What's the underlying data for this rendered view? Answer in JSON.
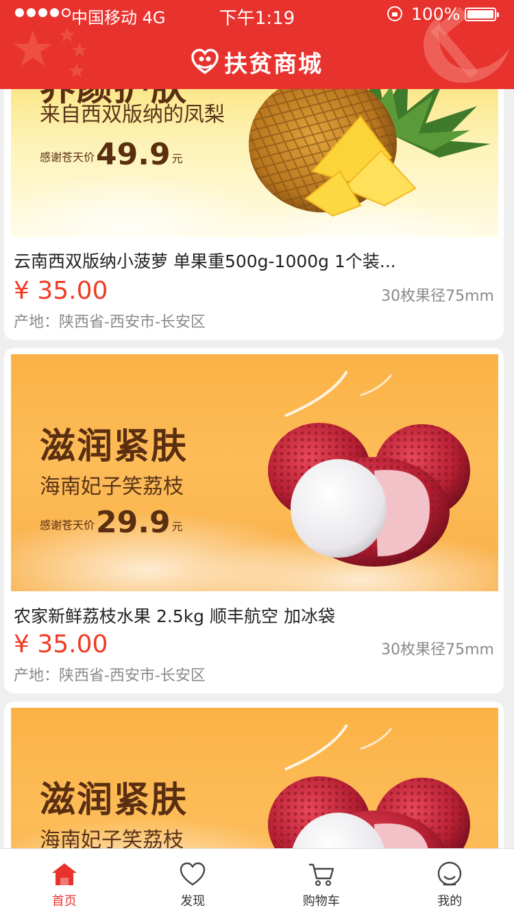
{
  "status_bar": {
    "carrier": "中国移动  4G",
    "time": "下午1:19",
    "battery": "100%"
  },
  "header": {
    "title": "扶贫商城"
  },
  "products": [
    {
      "banner": {
        "heading": "养颜护肤",
        "subheading": "来自西双版纳的凤梨",
        "price_label": "感谢苍天价",
        "price": "49.9",
        "unit": "元",
        "fruit": "pineapple"
      },
      "title": "云南西双版纳小菠萝 单果重500g-1000g 1个装...",
      "price": "¥ 35.00",
      "spec": "30枚果径75mm",
      "origin": "产地：陕西省-西安市-长安区"
    },
    {
      "banner": {
        "heading": "滋润紧肤",
        "subheading": "海南妃子笑荔枝",
        "price_label": "感谢苍天价",
        "price": "29.9",
        "unit": "元",
        "fruit": "lychee"
      },
      "title": "农家新鲜荔枝水果 2.5kg 顺丰航空 加冰袋",
      "price": "¥ 35.00",
      "spec": "30枚果径75mm",
      "origin": "产地：陕西省-西安市-长安区"
    },
    {
      "banner": {
        "heading": "滋润紧肤",
        "subheading": "海南妃子笑荔枝",
        "fruit": "lychee"
      }
    }
  ],
  "tabbar": {
    "items": [
      {
        "label": "首页",
        "icon": "home-icon",
        "active": true
      },
      {
        "label": "发现",
        "icon": "heart-icon",
        "active": false
      },
      {
        "label": "购物车",
        "icon": "cart-icon",
        "active": false
      },
      {
        "label": "我的",
        "icon": "user-icon",
        "active": false
      }
    ]
  },
  "colors": {
    "brand_red": "#e8322e",
    "price_red": "#f03a22",
    "banner_brown": "#5a2e10"
  }
}
